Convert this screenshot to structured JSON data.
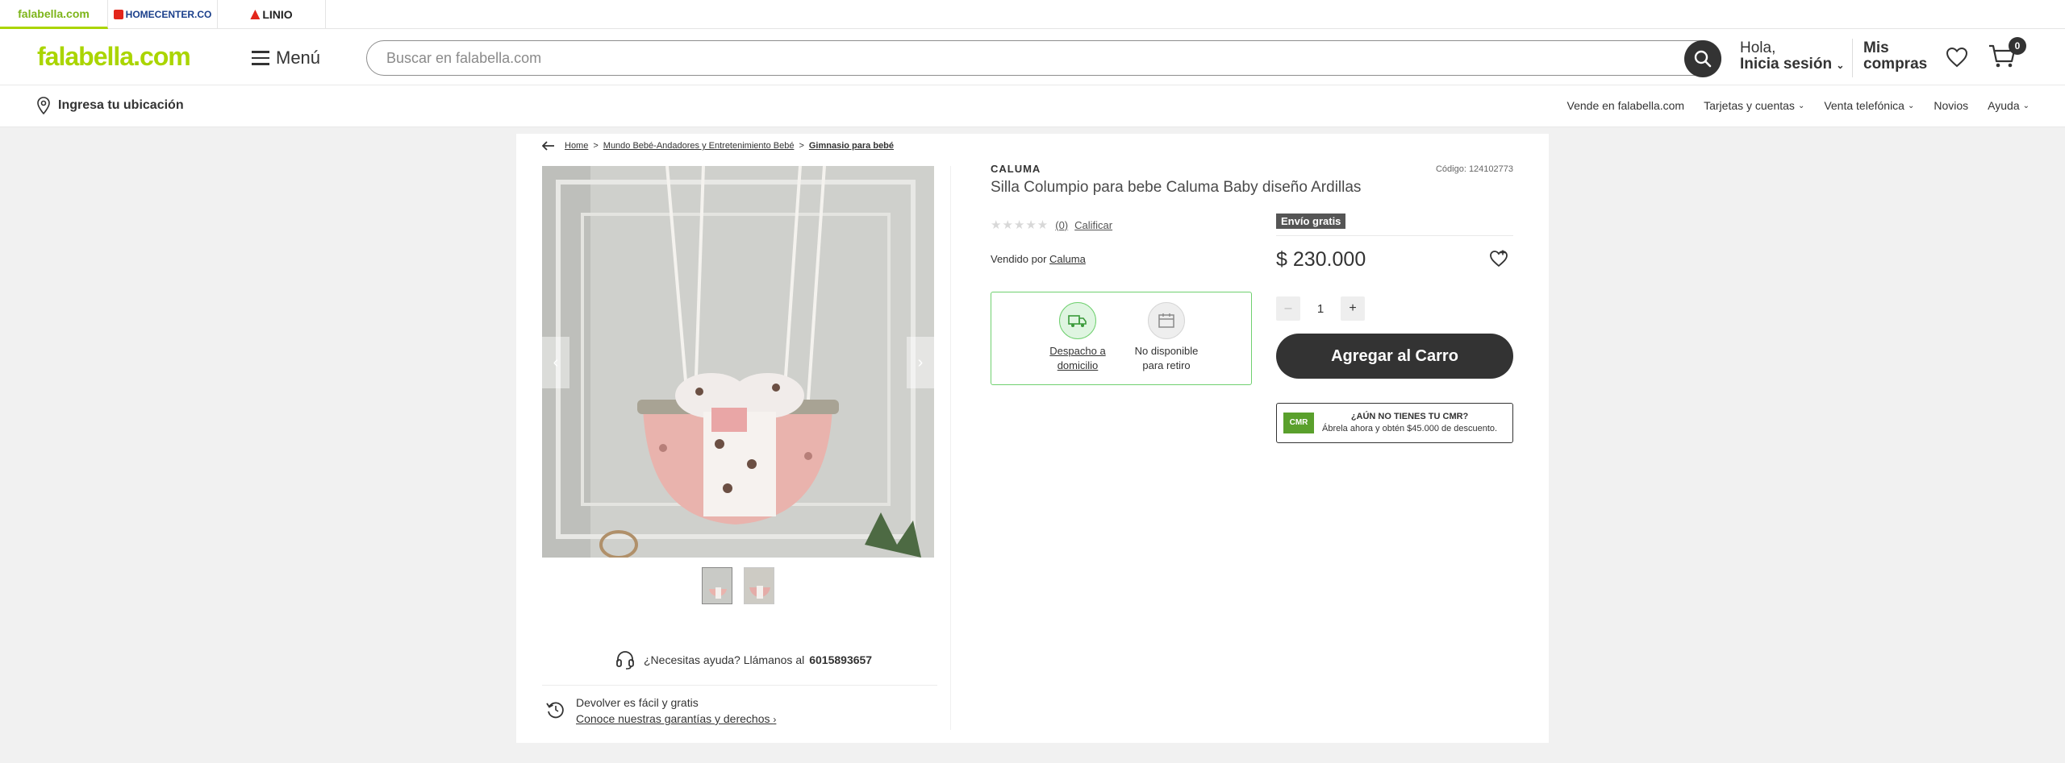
{
  "brands": {
    "falabella": "falabella.com",
    "homecenter": "HOMECENTER.CO",
    "linio": "LINIO"
  },
  "header": {
    "logo": "falabella.com",
    "menu_label": "Menú",
    "search_placeholder": "Buscar en falabella.com",
    "greeting_line1": "Hola,",
    "greeting_line2": "Inicia sesión",
    "mis_line1": "Mis",
    "mis_line2": "compras",
    "cart_count": "0"
  },
  "subheader": {
    "location": "Ingresa tu ubicación",
    "links": [
      "Vende en falabella.com",
      "Tarjetas y cuentas",
      "Venta telefónica",
      "Novios",
      "Ayuda"
    ]
  },
  "breadcrumb": {
    "home": "Home",
    "category": "Mundo Bebé-Andadores y Entretenimiento Bebé",
    "current": "Gimnasio para bebé"
  },
  "product": {
    "brand": "CALUMA",
    "code": "Código: 124102773",
    "title": "Silla Columpio para bebe Caluma Baby diseño Ardillas",
    "rating_count": "(0)",
    "rate_label": "Calificar",
    "rating_value": 0,
    "seller_prefix": "Vendido por",
    "seller_name": "Caluma",
    "free_shipping": "Envío gratis",
    "price": "$ 230.000",
    "quantity": "1",
    "add_to_cart": "Agregar al Carro",
    "delivery_label_1": "Despacho a",
    "delivery_label_2": "domicilio",
    "pickup_label_1": "No disponible",
    "pickup_label_2": "para retiro"
  },
  "cmr": {
    "logo_text": "CMR",
    "title": "¿AÚN NO TIENES TU CMR?",
    "subtitle": "Ábrela ahora y obtén $45.000 de descuento."
  },
  "help": {
    "text": "¿Necesitas ayuda? Llámanos al",
    "phone": "6015893657"
  },
  "returns": {
    "line1": "Devolver es fácil y gratis",
    "line2": "Conoce nuestras garantías y derechos"
  },
  "colors": {
    "brand_green": "#aad500",
    "dark": "#333333",
    "delivery_green": "#6fd06f"
  }
}
